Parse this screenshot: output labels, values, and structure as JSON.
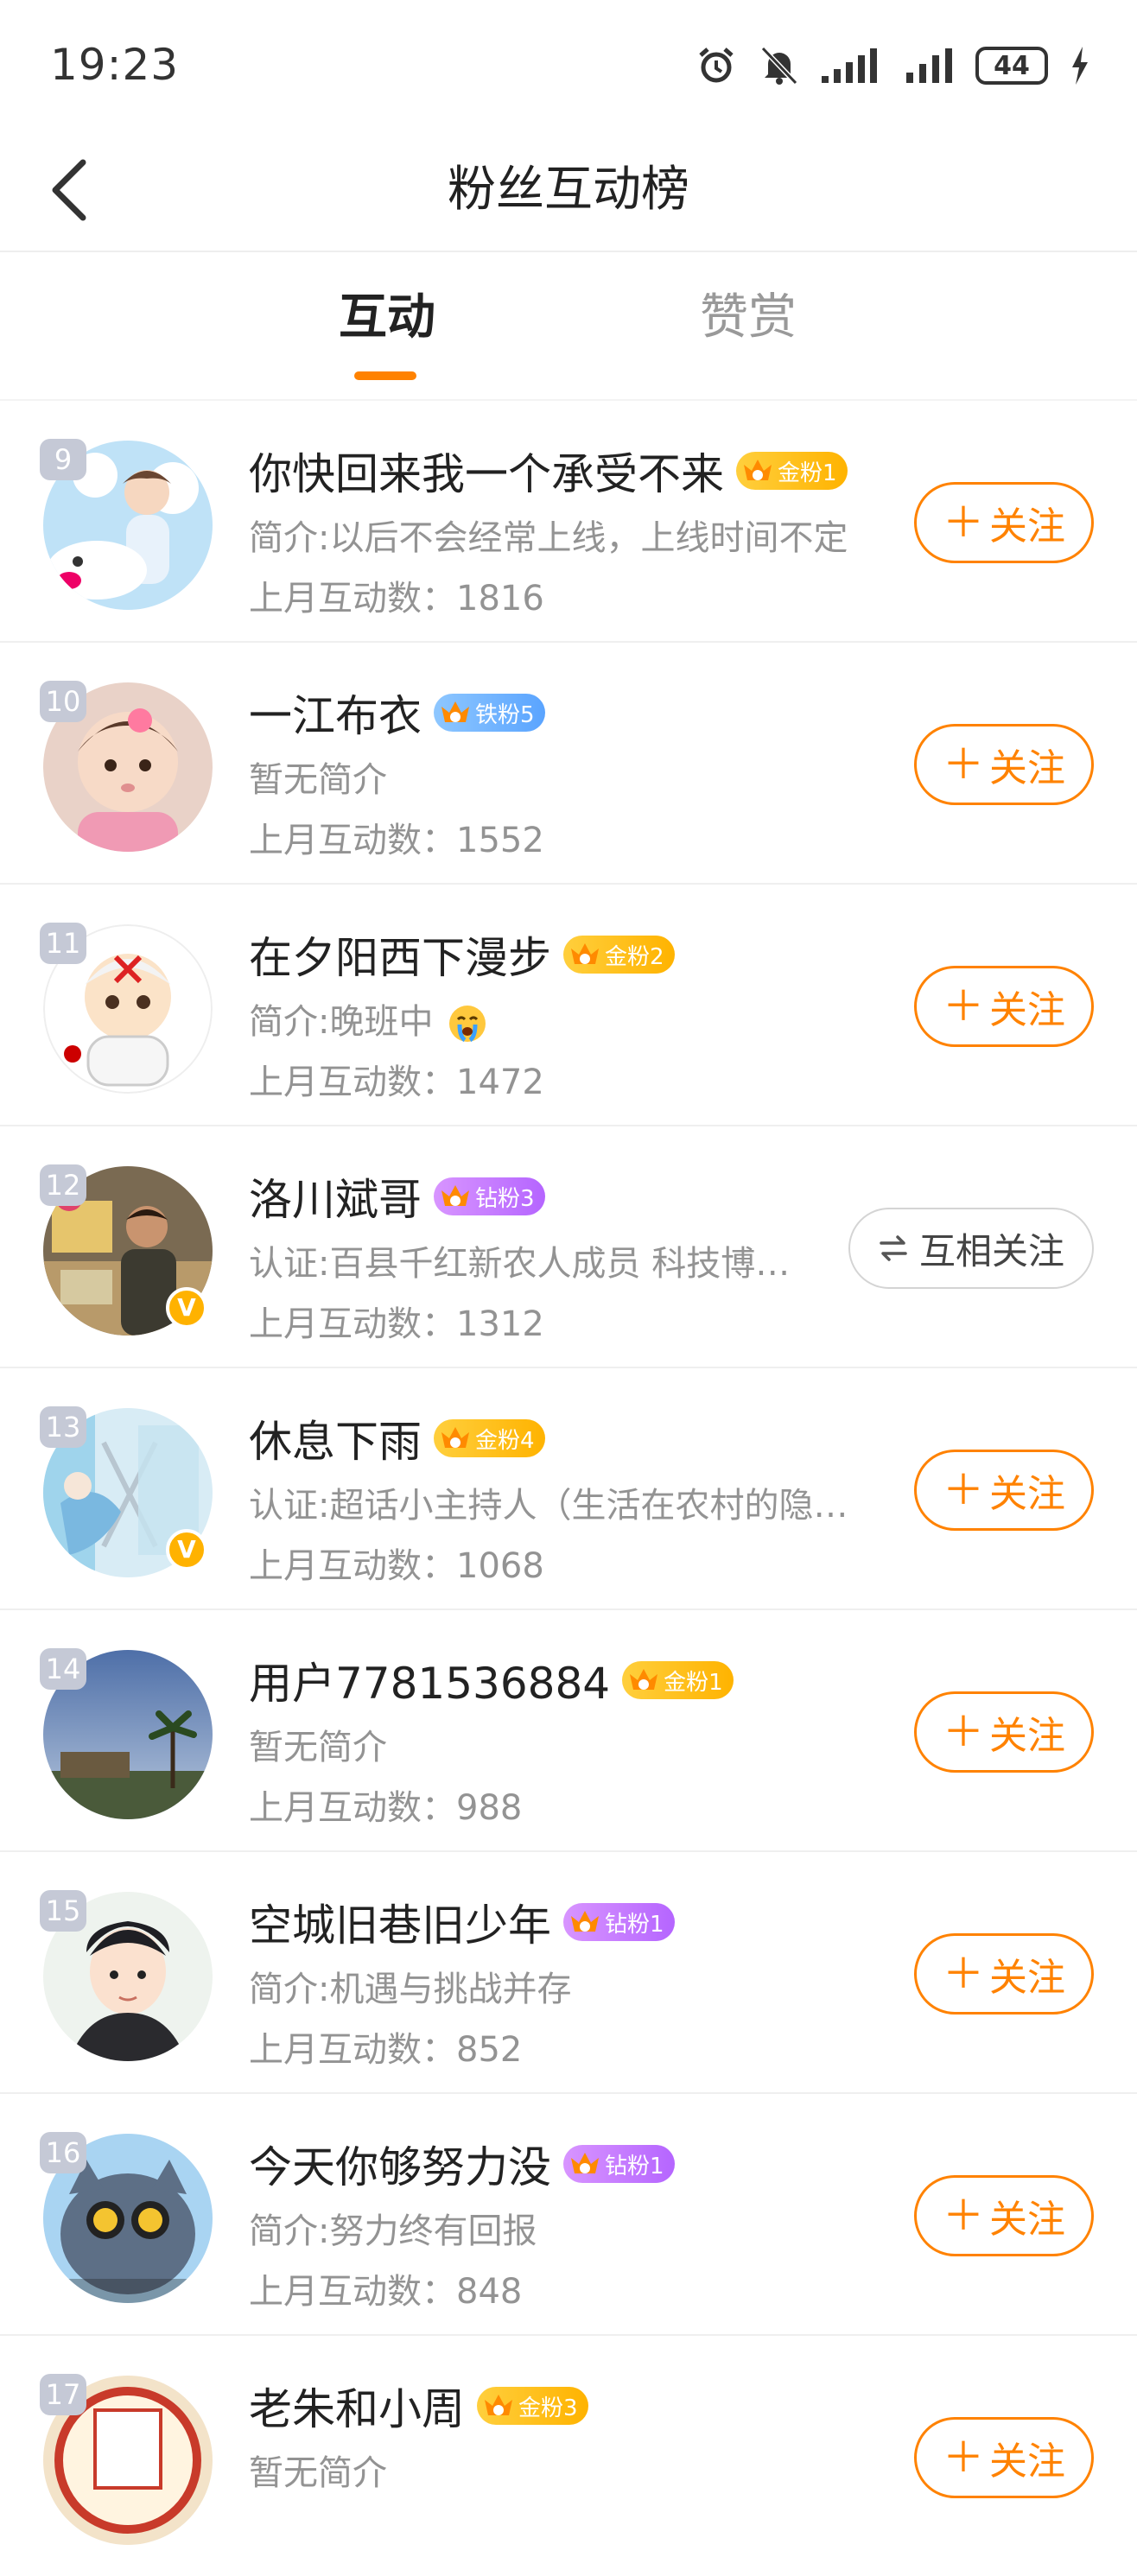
{
  "status_bar": {
    "time": "19:23",
    "battery": "44"
  },
  "header": {
    "title": "粉丝互动榜"
  },
  "tabs": [
    {
      "label": "互动",
      "active": true
    },
    {
      "label": "赞赏",
      "active": false
    }
  ],
  "colors": {
    "accent": "#ff8200",
    "gold_tag": "#ffb300",
    "iron_tag": "#5aa4ff",
    "diamond_tag": "#b565ff",
    "rank_badge": "#c5c9d6",
    "verified": "#ffb200"
  },
  "follow_label": "关注",
  "mutual_label": "互相关注",
  "fans": [
    {
      "rank": "9",
      "name": "你快回来我一个承受不来",
      "tag": "金粉1",
      "tag_type": "gold",
      "intro": "简介:以后不会经常上线，上线时间不定",
      "stat": "上月互动数：1816",
      "button": "follow",
      "verified": false
    },
    {
      "rank": "10",
      "name": "一江布衣",
      "tag": "铁粉5",
      "tag_type": "iron",
      "intro": "暂无简介",
      "stat": "上月互动数：1552",
      "button": "follow",
      "verified": false
    },
    {
      "rank": "11",
      "name": "在夕阳西下漫步",
      "tag": "金粉2",
      "tag_type": "gold",
      "intro": "简介:晚班中",
      "intro_emoji": "crying-face-icon",
      "stat": "上月互动数：1472",
      "button": "follow",
      "verified": false
    },
    {
      "rank": "12",
      "name": "洛川斌哥",
      "tag": "钻粉3",
      "tag_type": "diamond",
      "intro": "认证:百县千红新农人成员 科技博…",
      "stat": "上月互动数：1312",
      "button": "mutual",
      "verified": true
    },
    {
      "rank": "13",
      "name": "休息下雨",
      "tag": "金粉4",
      "tag_type": "gold",
      "intro": "认证:超话小主持人（生活在农村的隐…",
      "stat": "上月互动数：1068",
      "button": "follow",
      "verified": true
    },
    {
      "rank": "14",
      "name": "用户7781536884",
      "tag": "金粉1",
      "tag_type": "gold",
      "intro": "暂无简介",
      "stat": "上月互动数：988",
      "button": "follow",
      "verified": false
    },
    {
      "rank": "15",
      "name": "空城旧巷旧少年",
      "tag": "钻粉1",
      "tag_type": "diamond",
      "intro": "简介:机遇与挑战并存",
      "stat": "上月互动数：852",
      "button": "follow",
      "verified": false
    },
    {
      "rank": "16",
      "name": "今天你够努力没",
      "tag": "钻粉1",
      "tag_type": "diamond",
      "intro": "简介:努力终有回报",
      "stat": "上月互动数：848",
      "button": "follow",
      "verified": false
    },
    {
      "rank": "17",
      "name": "老朱和小周",
      "tag": "金粉3",
      "tag_type": "gold",
      "intro": "暂无简介",
      "stat": "",
      "button": "follow",
      "verified": false
    }
  ]
}
